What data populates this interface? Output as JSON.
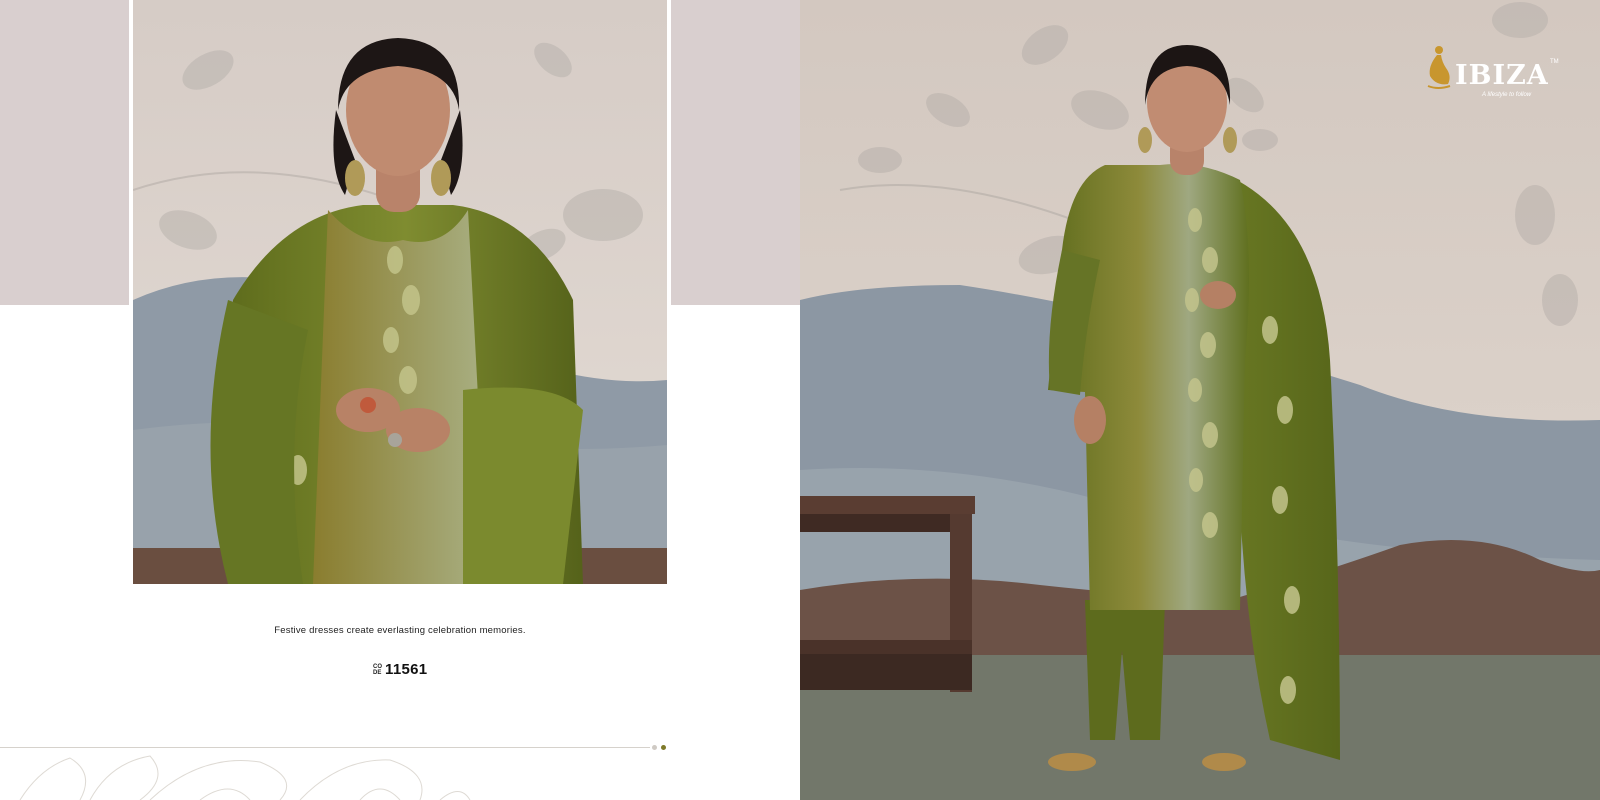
{
  "left_page": {
    "tagline": "Festive dresses create everlasting celebration memories.",
    "code_prefix_top": "CO",
    "code_prefix_bottom": "DE",
    "code_value": "11561",
    "pagination": {
      "dots": 2,
      "active": 2
    }
  },
  "right_page": {
    "brand": {
      "name": "IBIZA",
      "trademark": "TM",
      "tagline": "A lifestyle to follow"
    }
  },
  "colors": {
    "wall": "#d9cfc6",
    "mountain": "#8c98a3",
    "outfit_green": "#6b7a22",
    "outfit_gold": "#a89a4a",
    "accent_dot": "#7e7a2a",
    "band": "#d9cfcf"
  }
}
